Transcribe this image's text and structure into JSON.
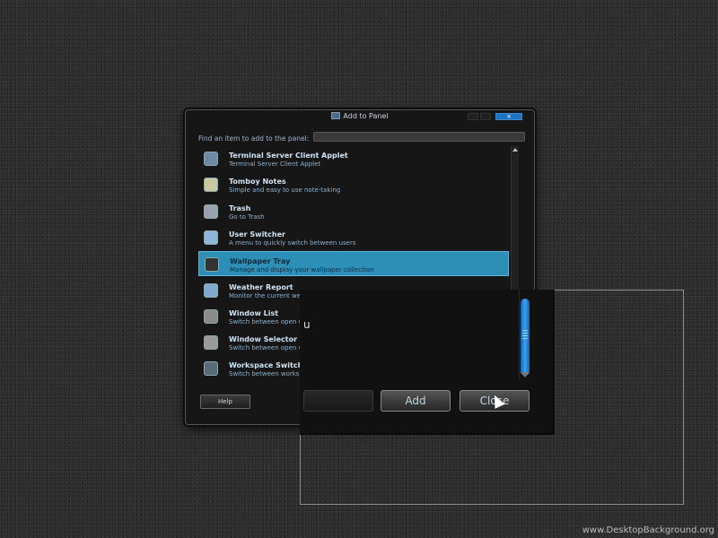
{
  "window": {
    "title": "Add to Panel",
    "close_label": "×"
  },
  "search": {
    "label": "Find an item to add to the panel:",
    "value": ""
  },
  "items": [
    {
      "name": "Terminal Server Client Applet",
      "desc": "Terminal Server Client Applet",
      "icon": "monitor-icon",
      "color": "#6e8aa6"
    },
    {
      "name": "Tomboy Notes",
      "desc": "Simple and easy to use note-taking",
      "icon": "notes-icon",
      "color": "#c9c9a0"
    },
    {
      "name": "Trash",
      "desc": "Go to Trash",
      "icon": "trash-icon",
      "color": "#9aa3ad"
    },
    {
      "name": "User Switcher",
      "desc": "A menu to quickly switch between users",
      "icon": "user-icon",
      "color": "#8db7d8"
    },
    {
      "name": "Wallpaper Tray",
      "desc": "Manage and display your wallpaper collection",
      "icon": "wallpaper-icon",
      "color": "#333333"
    },
    {
      "name": "Weather Report",
      "desc": "Monitor the current wea",
      "icon": "weather-icon",
      "color": "#7faad0"
    },
    {
      "name": "Window List",
      "desc": "Switch between open w",
      "icon": "window-list-icon",
      "color": "#8a8a8a"
    },
    {
      "name": "Window Selector",
      "desc": "Switch between open w",
      "icon": "window-selector-icon",
      "color": "#9a9a9a"
    },
    {
      "name": "Workspace Switcher",
      "desc": "Switch between worksp",
      "icon": "workspace-icon",
      "color": "#5a6a7a"
    }
  ],
  "selected_index": 4,
  "buttons": {
    "help": "Help",
    "add": "Add",
    "close": "Close"
  },
  "magnifier_fragment": "u",
  "watermark": "www.DesktopBackground.org",
  "colors": {
    "selection": "#2d8fb6",
    "scrollbar_thumb": "#1e73bf"
  }
}
